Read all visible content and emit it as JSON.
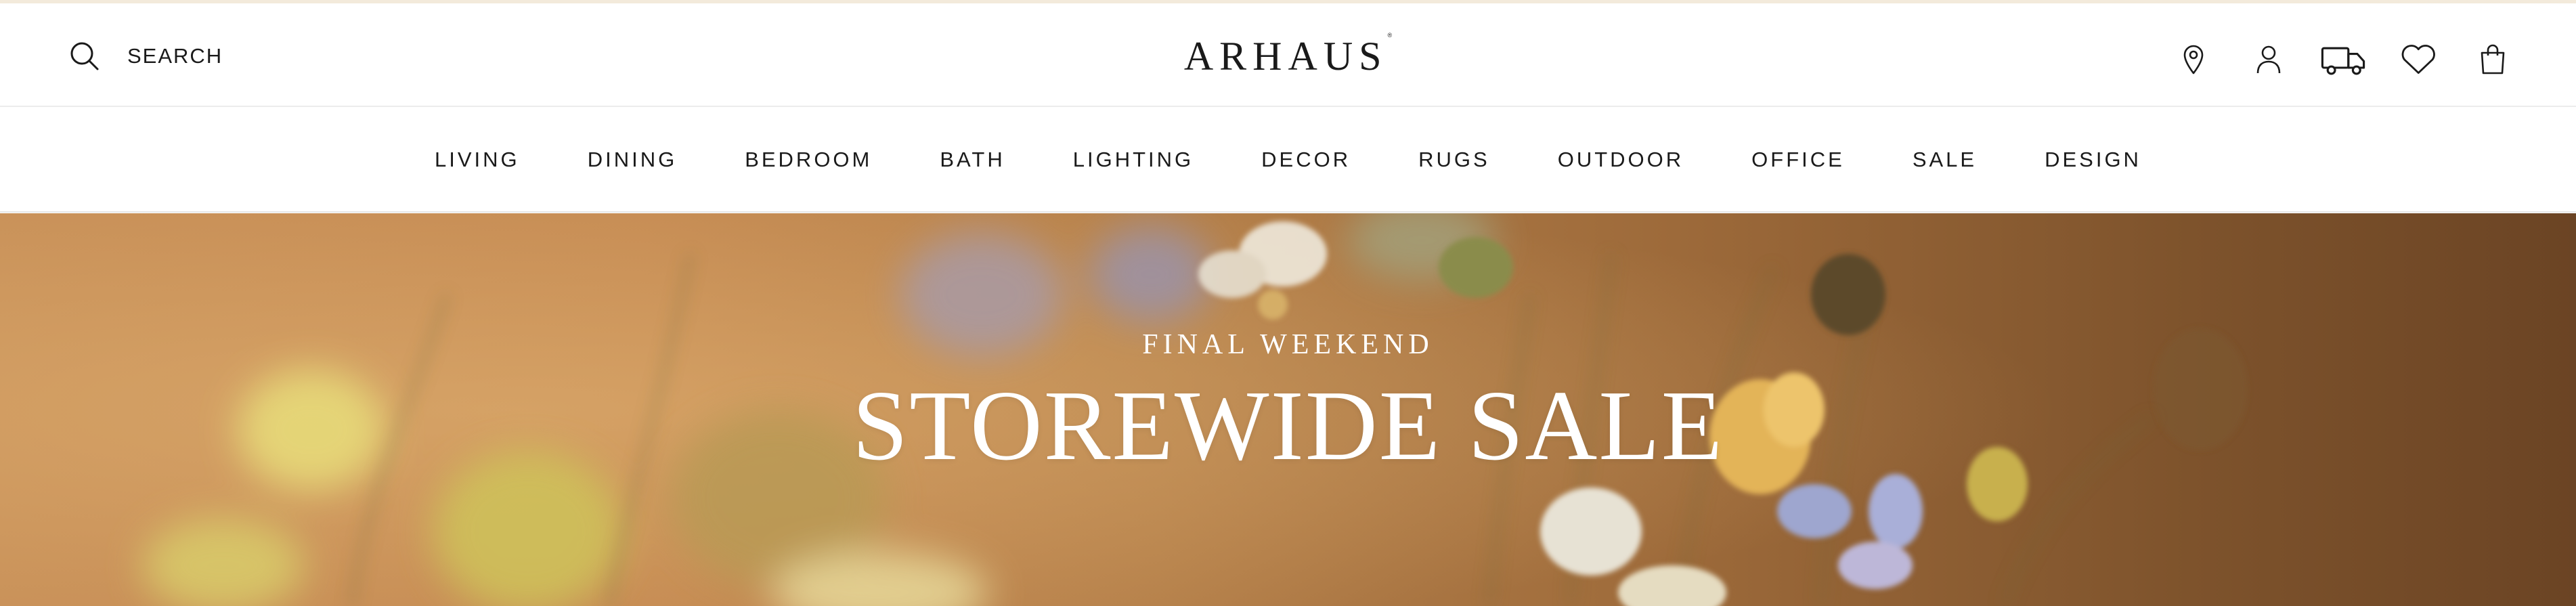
{
  "header": {
    "search_label": "SEARCH",
    "logo_text": "ARHAUS",
    "logo_mark": "®",
    "icons": [
      "location-pin-icon",
      "account-icon",
      "delivery-truck-icon",
      "wishlist-heart-icon",
      "shopping-bag-icon"
    ]
  },
  "nav": {
    "items": [
      "LIVING",
      "DINING",
      "BEDROOM",
      "BATH",
      "LIGHTING",
      "DECOR",
      "RUGS",
      "OUTDOOR",
      "OFFICE",
      "SALE",
      "DESIGN"
    ]
  },
  "hero": {
    "eyebrow": "FINAL WEEKEND",
    "headline": "STOREWIDE SALE"
  },
  "colors": {
    "text": "#1a1a1a",
    "top_rule": "#f3eadb",
    "hero_warm": "#c58a52",
    "hero_dark": "#6b4424",
    "hero_text": "#ffffff"
  }
}
